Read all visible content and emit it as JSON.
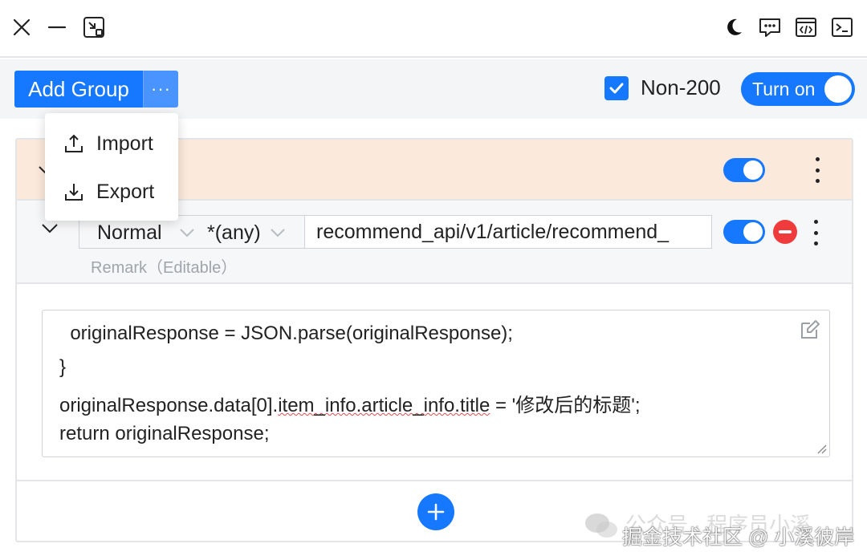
{
  "titlebar": {
    "icons": [
      "close-icon",
      "minimize-icon",
      "shrink-window-icon",
      "dark-mode-moon-icon",
      "chat-bubble-icon",
      "code-window-icon",
      "terminal-icon"
    ]
  },
  "toolbar": {
    "add_group_label": "Add Group",
    "more_label": "···",
    "non200_checked": true,
    "non200_label": "Non-200",
    "turn_on_label": "Turn on",
    "accent": "#1677ff"
  },
  "dropdown": {
    "items": [
      {
        "label": "Import",
        "icon": "upload-icon"
      },
      {
        "label": "Export",
        "icon": "download-icon"
      }
    ]
  },
  "group": {
    "header_bg": "#fbe9dc",
    "enabled": true
  },
  "rule": {
    "type": "Normal",
    "method": "*(any)",
    "url": "recommend_api/v1/article/recommend_",
    "remark_placeholder": "Remark（Editable）",
    "enabled": true
  },
  "editor": {
    "lines": [
      "  originalResponse = JSON.parse(originalResponse);",
      "}"
    ],
    "line3_pre": "originalResponse.data[0].",
    "line3_err": "item_info.article_info.title",
    "line3_post": " = '修改后的标题';",
    "line4": "return originalResponse;"
  },
  "watermark": {
    "line1": "公众号 · 程序员小溪",
    "line2": "掘金技术社区 @ 小溪彼岸"
  }
}
